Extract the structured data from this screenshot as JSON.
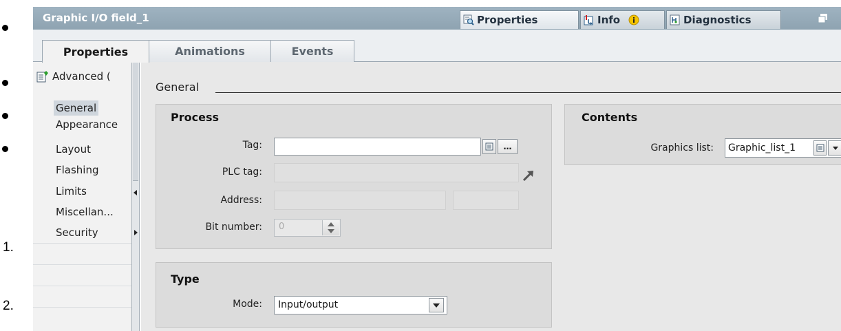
{
  "outline": {
    "item1": "1.",
    "item2": "2."
  },
  "titlebar": {
    "title": "Graphic I/O field_1",
    "tabs": [
      {
        "label": "Properties",
        "icon": "magnifier-list-icon"
      },
      {
        "label": "Info",
        "icon": "info-arrow-icon"
      },
      {
        "label": "Diagnostics",
        "icon": "diagnostics-icon"
      }
    ],
    "window_icon": "restore-window-icon"
  },
  "subtabs": [
    "Properties",
    "Animations",
    "Events"
  ],
  "nav": {
    "header": "Advanced (",
    "items": [
      "General",
      "Appearance",
      "Layout",
      "Flashing",
      "Limits",
      "Miscellan...",
      "Security"
    ],
    "selected": "General"
  },
  "main": {
    "section": "General",
    "process": {
      "title": "Process",
      "tag_label": "Tag:",
      "tag_value": "",
      "plc_tag_label": "PLC tag:",
      "address_label": "Address:",
      "bit_label": "Bit number:",
      "bit_value": "0"
    },
    "type": {
      "title": "Type",
      "mode_label": "Mode:",
      "mode_value": "Input/output"
    },
    "contents": {
      "title": "Contents",
      "graphics_label": "Graphics list:",
      "graphics_value": "Graphic_list_1"
    }
  },
  "colors": {
    "titlebar": "#97abb9",
    "panel": "#dcdcdc",
    "background": "#e8e8e8"
  }
}
